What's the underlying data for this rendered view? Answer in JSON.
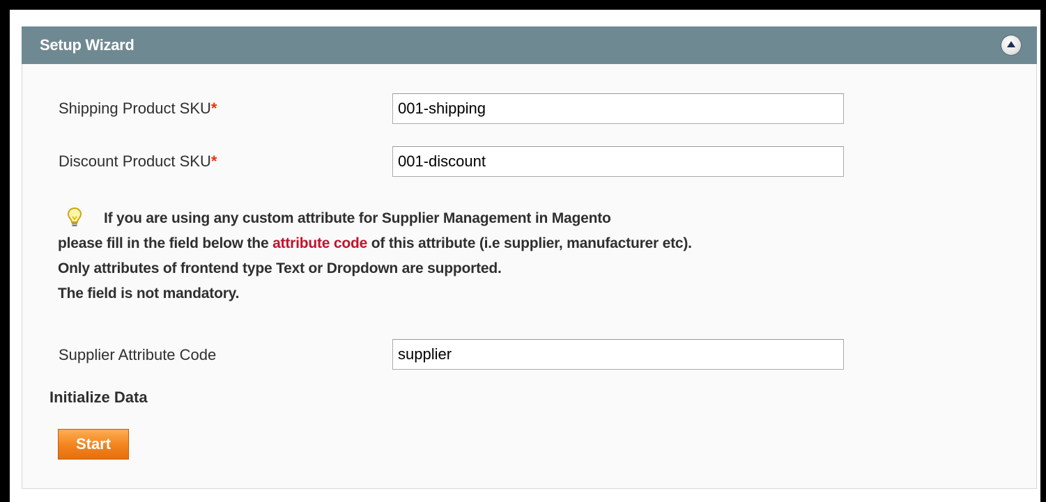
{
  "panel": {
    "title": "Setup Wizard"
  },
  "form": {
    "shipping_sku": {
      "label": "Shipping Product SKU",
      "required_mark": "*",
      "value": "001-shipping"
    },
    "discount_sku": {
      "label": "Discount Product SKU",
      "required_mark": "*",
      "value": "001-discount"
    },
    "note": {
      "icon": "lightbulb-icon",
      "line1": "If you are using any custom attribute for Supplier Management in Magento",
      "line2_before": "please fill in the field below the ",
      "line2_link": "attribute code",
      "line2_after": " of this attribute (i.e supplier, manufacturer etc).",
      "line3": "Only attributes of frontend type Text or Dropdown are supported.",
      "line4": "The field is not mandatory."
    },
    "supplier_attribute": {
      "label": "Supplier Attribute Code",
      "value": "supplier"
    }
  },
  "initialize": {
    "title": "Initialize Data",
    "start_label": "Start"
  },
  "colors": {
    "header_bg": "#6f8992",
    "required": "#eb340a",
    "link": "#c0132b",
    "button": "#f2831d"
  }
}
